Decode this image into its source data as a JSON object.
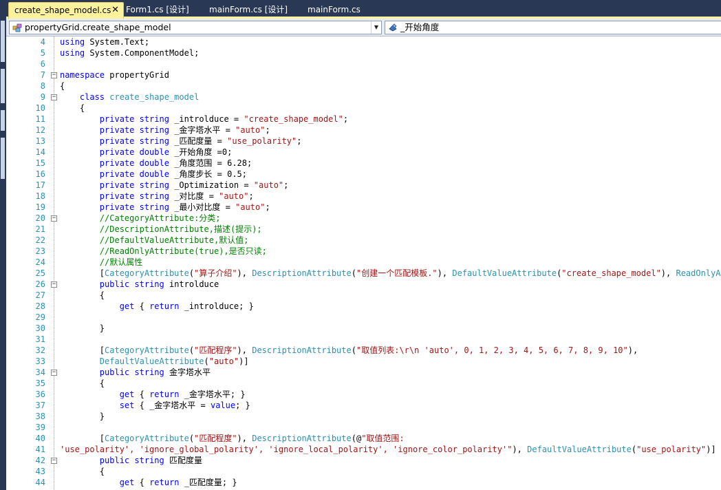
{
  "tabs": [
    {
      "label": "create_shape_model.cs",
      "active": true
    },
    {
      "label": "Form1.cs [设计]",
      "active": false
    },
    {
      "label": "mainForm.cs [设计]",
      "active": false
    },
    {
      "label": "mainForm.cs",
      "active": false
    }
  ],
  "tab_close_glyph": "✕",
  "nav": {
    "type_selector": "propertyGrid.create_shape_model",
    "member_selector": "_开始角度"
  },
  "lines": [
    {
      "n": "4",
      "code": "using System.Text;"
    },
    {
      "n": "5",
      "code": "using System.ComponentModel;"
    },
    {
      "n": "6",
      "code": ""
    },
    {
      "n": "7",
      "code": "namespace propertyGrid"
    },
    {
      "n": "8",
      "code": "{"
    },
    {
      "n": "9",
      "code": "    class create_shape_model"
    },
    {
      "n": "10",
      "code": "    {"
    },
    {
      "n": "11",
      "code": "        private string _introlduce = \"create_shape_model\";"
    },
    {
      "n": "12",
      "code": "        private string _金字塔水平 = \"auto\";"
    },
    {
      "n": "13",
      "code": "        private string _匹配度量 = \"use_polarity\";"
    },
    {
      "n": "14",
      "code": "        private double _开始角度 =0;"
    },
    {
      "n": "15",
      "code": "        private double _角度范围 = 6.28;"
    },
    {
      "n": "16",
      "code": "        private double _角度步长 = 0.5;"
    },
    {
      "n": "17",
      "code": "        private string _Optimization = \"auto\";"
    },
    {
      "n": "18",
      "code": "        private string _对比度 = \"auto\";"
    },
    {
      "n": "19",
      "code": "        private string _最小对比度 = \"auto\";"
    },
    {
      "n": "20",
      "code": "        //CategoryAttribute:分类;"
    },
    {
      "n": "21",
      "code": "        //DescriptionAttribute,描述(提示);"
    },
    {
      "n": "22",
      "code": "        //DefaultValueAttribute,默认值;"
    },
    {
      "n": "23",
      "code": "        //ReadOnlyAttribute(true),是否只读;"
    },
    {
      "n": "24",
      "code": "        //默认属性"
    },
    {
      "n": "25",
      "code": "        [CategoryAttribute(\"算子介绍\"), DescriptionAttribute(\"创建一个匹配模板.\"), DefaultValueAttribute(\"create_shape_model\"), ReadOnlyAttribute(true)]"
    },
    {
      "n": "26",
      "code": "        public string introlduce"
    },
    {
      "n": "27",
      "code": "        {"
    },
    {
      "n": "28",
      "code": "            get { return _introlduce; }"
    },
    {
      "n": "29",
      "code": ""
    },
    {
      "n": "30",
      "code": "        }"
    },
    {
      "n": "31",
      "code": ""
    },
    {
      "n": "32",
      "code": "        [CategoryAttribute(\"匹配程序\"), DescriptionAttribute(\"取值列表:\\r\\n 'auto', 0, 1, 2, 3, 4, 5, 6, 7, 8, 9, 10\"),"
    },
    {
      "n": "33",
      "code": "        DefaultValueAttribute(\"auto\")]"
    },
    {
      "n": "34",
      "code": "        public string 金字塔水平"
    },
    {
      "n": "35",
      "code": "        {"
    },
    {
      "n": "36",
      "code": "            get { return _金字塔水平; }"
    },
    {
      "n": "37",
      "code": "            set { _金字塔水平 = value; }"
    },
    {
      "n": "38",
      "code": "        }"
    },
    {
      "n": "39",
      "code": ""
    },
    {
      "n": "40",
      "code": "        [CategoryAttribute(\"匹配程度\"), DescriptionAttribute(@\"取值范围:"
    },
    {
      "n": "41",
      "code": "'use_polarity', 'ignore_global_polarity', 'ignore_local_polarity', 'ignore_color_polarity'\"), DefaultValueAttribute(\"use_polarity\")]"
    },
    {
      "n": "42",
      "code": "        public string 匹配度量"
    },
    {
      "n": "43",
      "code": "        {"
    },
    {
      "n": "44",
      "code": "            get { return _匹配度量; }"
    }
  ],
  "fold_markers": [
    {
      "line": "7",
      "glyph": "−"
    },
    {
      "line": "9",
      "glyph": "−"
    },
    {
      "line": "20",
      "glyph": "−"
    },
    {
      "line": "26",
      "glyph": "−"
    },
    {
      "line": "34",
      "glyph": "−"
    },
    {
      "line": "42",
      "glyph": "−"
    }
  ],
  "colors": {
    "keyword": "#0000ff",
    "type": "#2b91af",
    "string": "#a31515",
    "comment": "#008000",
    "line_number": "#2b91af",
    "active_tab": "#fff29d",
    "chrome": "#293955"
  }
}
